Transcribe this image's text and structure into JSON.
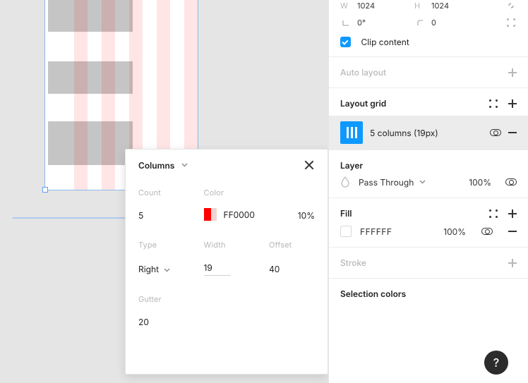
{
  "popup": {
    "title": "Columns",
    "count_label": "Count",
    "count_value": "5",
    "color_label": "Color",
    "color_hex": "FF0000",
    "color_opacity": "10%",
    "type_label": "Type",
    "type_value": "Right",
    "width_label": "Width",
    "width_value": "19",
    "offset_label": "Offset",
    "offset_value": "40",
    "gutter_label": "Gutter",
    "gutter_value": "20"
  },
  "inspector": {
    "dimensions": {
      "w_label": "W",
      "w_value": "1024",
      "h_label": "H",
      "h_value": "1024",
      "rotation_value": "0°",
      "corner_value": "0"
    },
    "clip_label": "Clip content",
    "auto_layout_title": "Auto layout",
    "layout_grid": {
      "title": "Layout grid",
      "item_label": "5 columns (19px)"
    },
    "layer": {
      "title": "Layer",
      "blend_mode": "Pass Through",
      "opacity": "100%"
    },
    "fill": {
      "title": "Fill",
      "hex": "FFFFFF",
      "opacity": "100%"
    },
    "stroke_title": "Stroke",
    "selection_title": "Selection colors"
  },
  "help": "?"
}
